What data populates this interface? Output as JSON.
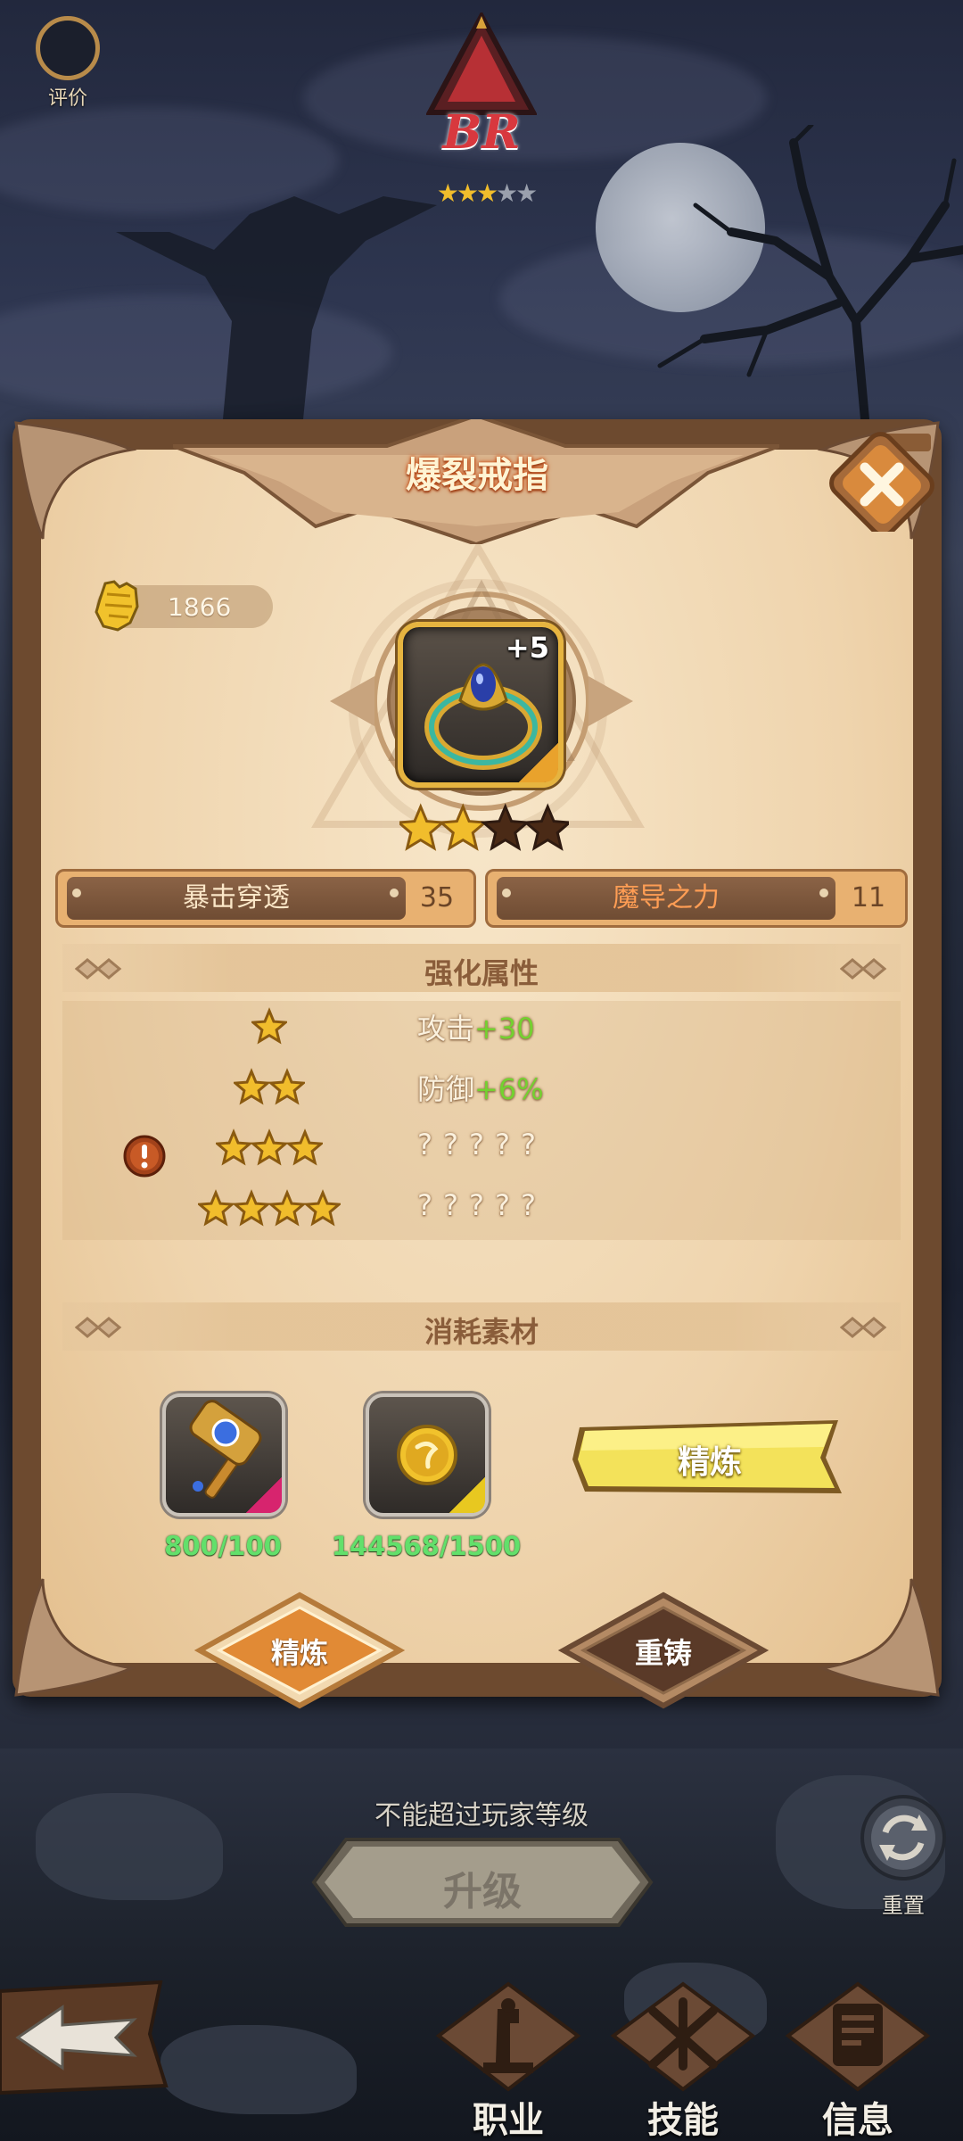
{
  "rating_label": "评价",
  "rank": {
    "text": "BR",
    "stars_total": 5,
    "stars_filled": 3
  },
  "item": {
    "name": "爆裂戒指",
    "combat_power": "1866",
    "enhance_level": "+5",
    "quality_stars_total": 4,
    "quality_stars_filled": 2
  },
  "stats": [
    {
      "label": "暴击穿透",
      "value": "35"
    },
    {
      "label": "魔导之力",
      "value": "11"
    }
  ],
  "enhance_section": {
    "title": "强化属性",
    "rows": [
      {
        "stars": 1,
        "name": "攻击",
        "bonus": "+30",
        "text": "",
        "warning": false
      },
      {
        "stars": 2,
        "name": "防御",
        "bonus": "+6%",
        "text": "",
        "warning": false
      },
      {
        "stars": 3,
        "name": "",
        "bonus": "",
        "text": "?????",
        "warning": true
      },
      {
        "stars": 4,
        "name": "",
        "bonus": "",
        "text": "?????",
        "warning": false
      }
    ]
  },
  "materials_section": {
    "title": "消耗素材",
    "items": [
      {
        "icon": "hammer-icon",
        "count": "800/100",
        "accent": "#d7246e"
      },
      {
        "icon": "gold-coin-icon",
        "count": "144568/1500",
        "accent": "#e8c820"
      }
    ],
    "action_label": "精炼"
  },
  "tabs": [
    {
      "label": "精炼",
      "active": true
    },
    {
      "label": "重铸",
      "active": false
    }
  ],
  "level_note": "不能超过玩家等级",
  "upgrade_label": "升级",
  "reset_label": "重置",
  "bottom_nav": [
    {
      "label": "职业",
      "icon": "class-icon"
    },
    {
      "label": "技能",
      "icon": "skill-icon"
    },
    {
      "label": "信息",
      "icon": "info-icon"
    }
  ],
  "colors": {
    "accent_green": "#74d130",
    "count_green": "#62e06b",
    "title_orange": "#d55a20",
    "star_gold": "#f1bd2c"
  }
}
